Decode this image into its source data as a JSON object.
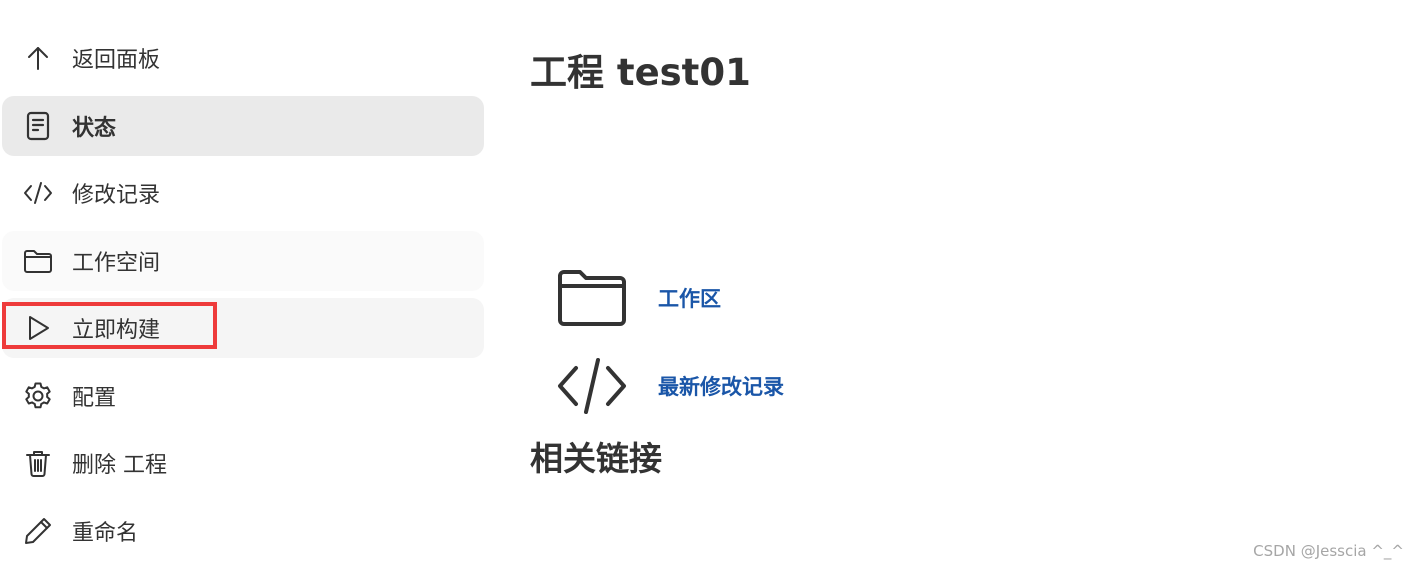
{
  "sidebar": {
    "items": [
      {
        "label": "返回面板",
        "icon": "arrow-up-icon"
      },
      {
        "label": "状态",
        "icon": "document-icon"
      },
      {
        "label": "修改记录",
        "icon": "code-icon"
      },
      {
        "label": "工作空间",
        "icon": "folder-icon"
      },
      {
        "label": "立即构建",
        "icon": "play-icon"
      },
      {
        "label": "配置",
        "icon": "gear-icon"
      },
      {
        "label": "删除 工程",
        "icon": "trash-icon"
      },
      {
        "label": "重命名",
        "icon": "pencil-icon"
      }
    ],
    "active_index": 1
  },
  "main": {
    "title": "工程 test01",
    "links": [
      {
        "label": "工作区",
        "icon": "folder-icon"
      },
      {
        "label": "最新修改记录",
        "icon": "code-icon"
      }
    ],
    "related_title": "相关链接"
  },
  "watermark": "CSDN @Jesscia ^_^",
  "colors": {
    "link": "#1a56a8",
    "active_bg": "#eaeaea",
    "highlight": "#ee3b3b",
    "text": "#333333"
  }
}
